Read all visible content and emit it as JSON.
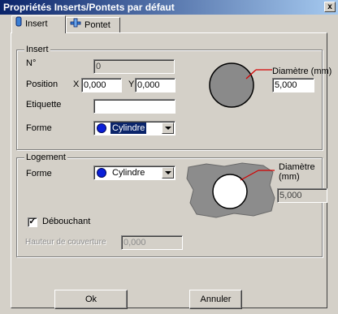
{
  "window": {
    "title": "Propriétés Inserts/Pontets par défaut",
    "close": "x"
  },
  "tabs": [
    {
      "label": "Insert",
      "icon": "insert-icon"
    },
    {
      "label": "Pontet",
      "icon": "pontet-icon"
    }
  ],
  "insert": {
    "legend": "Insert",
    "number_label": "N°",
    "number_value": "0",
    "position_label": "Position",
    "x_label": "X",
    "x_value": "0,000",
    "y_label": "Y",
    "y_value": "0,000",
    "label_label": "Etiquette",
    "label_value": "",
    "shape_label": "Forme",
    "shape_value": "Cylindre",
    "diameter_label": "Diamètre (mm)",
    "diameter_value": "5,000"
  },
  "housing": {
    "legend": "Logement",
    "shape_label": "Forme",
    "shape_value": "Cylindre",
    "diameter_label_line1": "Diamètre",
    "diameter_label_line2": "(mm)",
    "diameter_value": "5,000",
    "through_label": "Débouchant",
    "through_checked": true,
    "through_mark": "✓",
    "cover_label": "Hauteur de couverture",
    "cover_value": "0,000"
  },
  "buttons": {
    "ok": "Ok",
    "cancel": "Annuler"
  },
  "colors": {
    "title_start": "#0a246a",
    "title_end": "#a6caf0",
    "shape_blue": "#0a1fd8",
    "leader_red": "#d40000",
    "insert_disk": "#8a8a8a"
  }
}
